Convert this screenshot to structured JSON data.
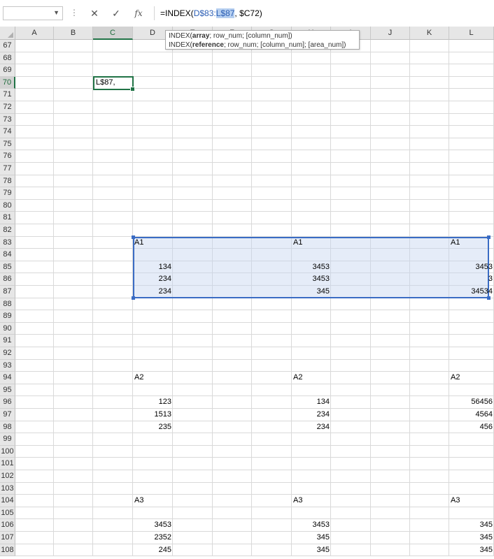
{
  "name_box": {
    "value": ""
  },
  "formula_bar": {
    "cancel_glyph": "✕",
    "enter_glyph": "✓",
    "fx_label": "fx",
    "prefix": "=INDEX(",
    "ref1": "D$83:",
    "ref2": "L$87",
    "suffix": ", $C72)"
  },
  "tooltip": {
    "line1_fn": "INDEX(",
    "line1_bold": "array",
    "line1_rest": "; row_num; [column_num])",
    "line2_fn": "INDEX(",
    "line2_bold": "reference",
    "line2_rest": "; row_num; [column_num]; [area_num])"
  },
  "columns": [
    "A",
    "B",
    "C",
    "D",
    "E",
    "F",
    "G",
    "H",
    "I",
    "J",
    "K",
    "L"
  ],
  "selected_column": "C",
  "selected_row": "70",
  "rows": [
    "67",
    "68",
    "69",
    "70",
    "71",
    "72",
    "73",
    "74",
    "75",
    "76",
    "77",
    "78",
    "79",
    "80",
    "81",
    "82",
    "83",
    "84",
    "85",
    "86",
    "87",
    "88",
    "89",
    "90",
    "91",
    "92",
    "93",
    "94",
    "95",
    "96",
    "97",
    "98",
    "99",
    "100",
    "101",
    "102",
    "103",
    "104",
    "105",
    "106",
    "107",
    "108"
  ],
  "active_cell": {
    "ref": "C70",
    "text": "L$87,"
  },
  "highlighted_range": "D83:L87",
  "cells": [
    {
      "row": "83",
      "col": "D",
      "text": "A1",
      "num": false
    },
    {
      "row": "83",
      "col": "H",
      "text": "A1",
      "num": false
    },
    {
      "row": "83",
      "col": "L",
      "text": "A1",
      "num": false
    },
    {
      "row": "85",
      "col": "D",
      "text": "134",
      "num": true
    },
    {
      "row": "85",
      "col": "H",
      "text": "3453",
      "num": true
    },
    {
      "row": "85",
      "col": "L",
      "text": "3453",
      "num": true
    },
    {
      "row": "86",
      "col": "D",
      "text": "234",
      "num": true
    },
    {
      "row": "86",
      "col": "H",
      "text": "3453",
      "num": true
    },
    {
      "row": "86",
      "col": "L",
      "text": "3",
      "num": true
    },
    {
      "row": "87",
      "col": "D",
      "text": "234",
      "num": true
    },
    {
      "row": "87",
      "col": "H",
      "text": "345",
      "num": true
    },
    {
      "row": "87",
      "col": "L",
      "text": "34534",
      "num": true
    },
    {
      "row": "94",
      "col": "D",
      "text": "A2",
      "num": false
    },
    {
      "row": "94",
      "col": "H",
      "text": "A2",
      "num": false
    },
    {
      "row": "94",
      "col": "L",
      "text": "A2",
      "num": false
    },
    {
      "row": "96",
      "col": "D",
      "text": "123",
      "num": true
    },
    {
      "row": "96",
      "col": "H",
      "text": "134",
      "num": true
    },
    {
      "row": "96",
      "col": "L",
      "text": "56456",
      "num": true
    },
    {
      "row": "97",
      "col": "D",
      "text": "1513",
      "num": true
    },
    {
      "row": "97",
      "col": "H",
      "text": "234",
      "num": true
    },
    {
      "row": "97",
      "col": "L",
      "text": "4564",
      "num": true
    },
    {
      "row": "98",
      "col": "D",
      "text": "235",
      "num": true
    },
    {
      "row": "98",
      "col": "H",
      "text": "234",
      "num": true
    },
    {
      "row": "98",
      "col": "L",
      "text": "456",
      "num": true
    },
    {
      "row": "104",
      "col": "D",
      "text": "A3",
      "num": false
    },
    {
      "row": "104",
      "col": "H",
      "text": "A3",
      "num": false
    },
    {
      "row": "104",
      "col": "L",
      "text": "A3",
      "num": false
    },
    {
      "row": "106",
      "col": "D",
      "text": "3453",
      "num": true
    },
    {
      "row": "106",
      "col": "H",
      "text": "3453",
      "num": true
    },
    {
      "row": "106",
      "col": "L",
      "text": "345",
      "num": true
    },
    {
      "row": "107",
      "col": "D",
      "text": "2352",
      "num": true
    },
    {
      "row": "107",
      "col": "H",
      "text": "345",
      "num": true
    },
    {
      "row": "107",
      "col": "L",
      "text": "345",
      "num": true
    },
    {
      "row": "108",
      "col": "D",
      "text": "245",
      "num": true
    },
    {
      "row": "108",
      "col": "H",
      "text": "345",
      "num": true
    },
    {
      "row": "108",
      "col": "L",
      "text": "345",
      "num": true
    }
  ],
  "colors": {
    "accent": "#217346",
    "range_border": "#3a6cc4",
    "ref_text": "#2b5eb4"
  }
}
